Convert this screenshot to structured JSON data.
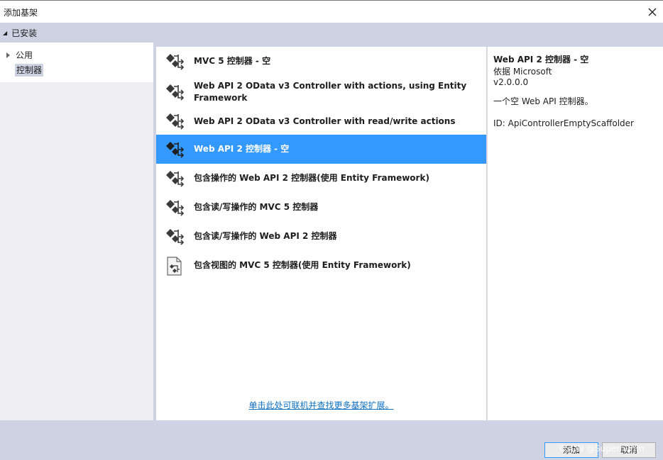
{
  "window": {
    "title": "添加基架"
  },
  "left": {
    "installed_label": "已安装",
    "tree": [
      {
        "label": "公用"
      },
      {
        "label": "控制器"
      }
    ]
  },
  "templates": [
    {
      "label": "MVC 5 控制器 - 空",
      "icon": "scaffold-controller-icon"
    },
    {
      "label": "Web API 2 OData v3 Controller with actions, using Entity Framework",
      "icon": "scaffold-controller-icon"
    },
    {
      "label": "Web API 2 OData v3 Controller with read/write actions",
      "icon": "scaffold-controller-icon"
    },
    {
      "label": "Web API 2 控制器 - 空",
      "icon": "scaffold-controller-icon",
      "selected": true
    },
    {
      "label": "包含操作的 Web API 2 控制器(使用 Entity Framework)",
      "icon": "scaffold-controller-icon"
    },
    {
      "label": "包含读/写操作的 MVC 5 控制器",
      "icon": "scaffold-controller-icon"
    },
    {
      "label": "包含读/写操作的 Web API 2 控制器",
      "icon": "scaffold-controller-icon"
    },
    {
      "label": "包含视图的 MVC 5 控制器(使用 Entity Framework)",
      "icon": "scaffold-view-icon"
    }
  ],
  "online_link": "单击此处可联机并查找更多基架扩展。",
  "details": {
    "title": "Web API 2 控制器 - 空",
    "author": "依据 Microsoft",
    "version": "v2.0.0.0",
    "description": "一个空 Web API 控制器。",
    "id": "ID: ApiControllerEmptyScaffolder"
  },
  "footer": {
    "add_label": "添加",
    "cancel_label": "取消",
    "watermark": "CSDN @Superhunm"
  },
  "colors": {
    "selection": "#3399ff",
    "link": "#0e70c0",
    "chrome": "#cdd3e3"
  }
}
